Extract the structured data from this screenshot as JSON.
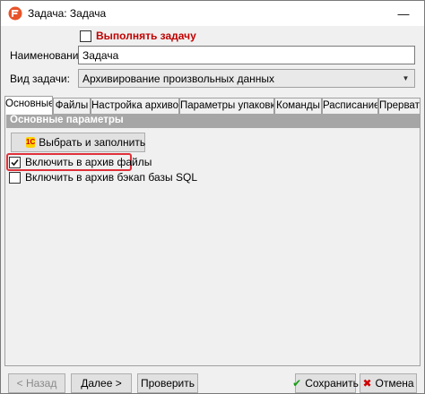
{
  "window": {
    "title": "Задача: Задача",
    "minimize_glyph": "—"
  },
  "task": {
    "execute_label": "Выполнять задачу",
    "name_label": "Наименование:",
    "name_value": "Задача",
    "type_label": "Вид задачи:",
    "type_value": "Архивирование произвольных данных"
  },
  "tabs": [
    {
      "label": "Основные"
    },
    {
      "label": "Файлы"
    },
    {
      "label": "Настройка архивов"
    },
    {
      "label": "Параметры упаковки"
    },
    {
      "label": "Команды"
    },
    {
      "label": "Расписание"
    },
    {
      "label": "Прервать"
    }
  ],
  "panel": {
    "section_title": "Основные параметры",
    "fill_button_label": "Выбрать и заполнить",
    "fill_button_badge": "1С",
    "options": [
      {
        "label": "Включить в архив файлы",
        "checked": true
      },
      {
        "label": "Включить в архив бэкап базы SQL",
        "checked": false
      }
    ]
  },
  "footer": {
    "back_label": "< Назад",
    "next_label": "Далее >",
    "check_label": "Проверить",
    "save_label": "Сохранить",
    "cancel_label": "Отмена"
  },
  "colors": {
    "accent_red": "#c00000",
    "highlight_red": "#e0303a",
    "save_check_green": "#1a9a1a",
    "cancel_x_red": "#d00000",
    "section_header_gray": "#a6a6a6"
  }
}
